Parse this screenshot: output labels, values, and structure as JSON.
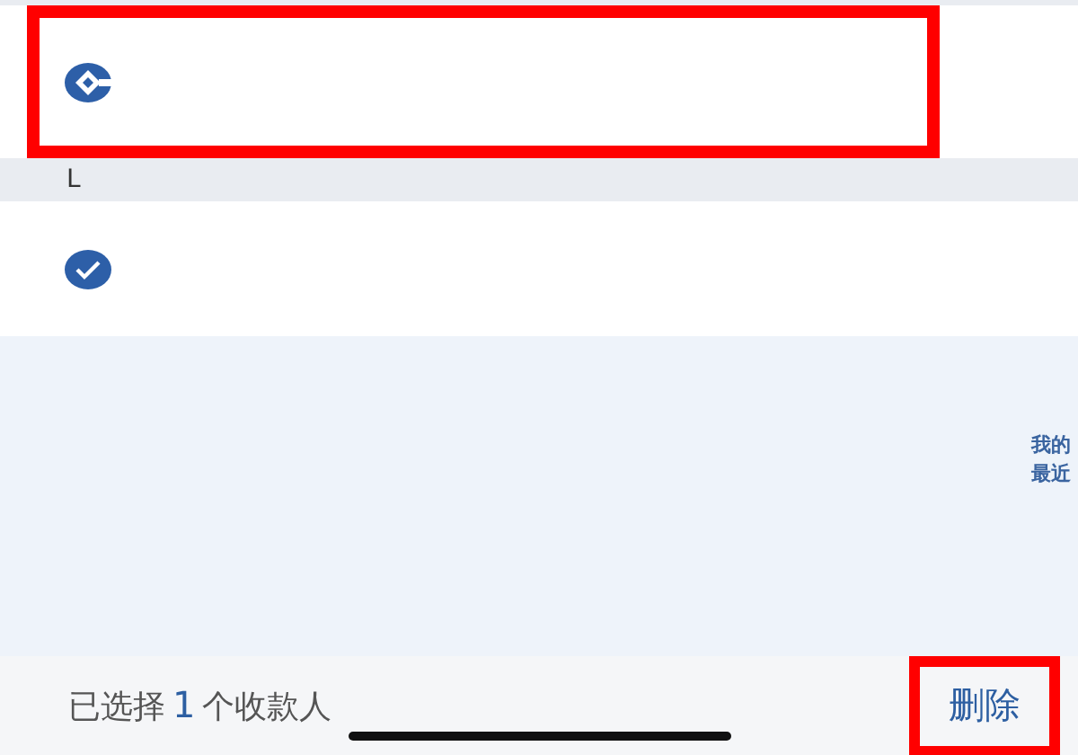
{
  "payees": [
    {
      "kind": "bank",
      "highlighted": true
    },
    {
      "section": "L"
    },
    {
      "kind": "check",
      "checked": true,
      "highlighted": false
    }
  ],
  "index_bar": [
    "我的",
    "最近"
  ],
  "footer": {
    "prefix": "已选择",
    "count": "1",
    "suffix": "个收款人",
    "delete_button": {
      "label": "删除",
      "highlighted": true
    }
  }
}
